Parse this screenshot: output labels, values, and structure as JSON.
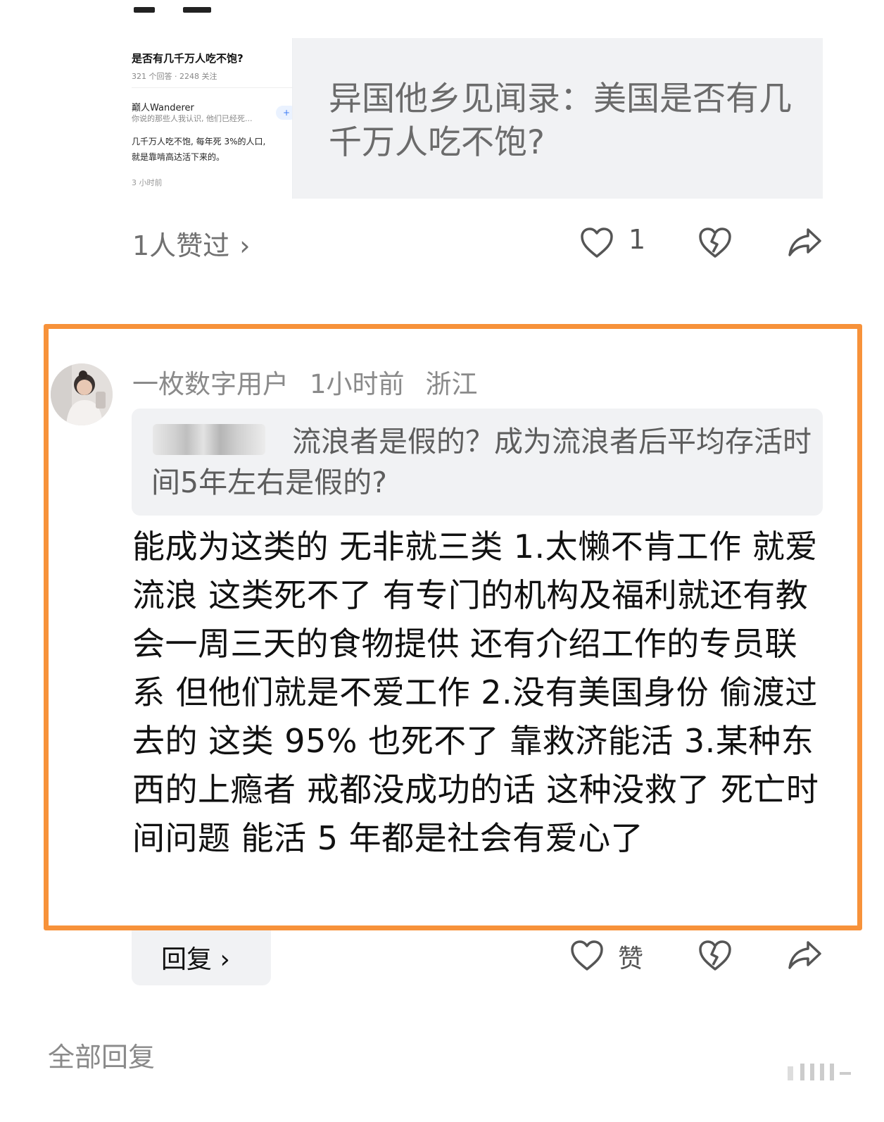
{
  "link_card": {
    "thumb_question": "是否有几千万人吃不饱?",
    "thumb_meta": "321 个回答 · 2248 关注",
    "thumb_author": "巅人Wanderer",
    "thumb_snippet": "你说的那些人我认识, 他们已经死...",
    "thumb_follow": "+",
    "thumb_body_1": "几千万人吃不饱, 每年死 3%的人口,",
    "thumb_body_2": "就是靠啃高达活下来的。",
    "thumb_time": "3 小时前",
    "title": "异国他乡见闻录：美国是否有几千万人吃不饱?"
  },
  "post_actions": {
    "likers_text": "1人赞过",
    "chevron": "›",
    "like_count": "1"
  },
  "comment": {
    "username": "一枚数字用户",
    "time": "1小时前",
    "location": "浙江",
    "quoted_text": "流浪者是假的？成为流浪者后平均存活时间5年左右是假的?",
    "body": "能成为这类的 无非就三类 1.太懒不肯工作 就爱流浪 这类死不了 有专门的机构及福利就还有教会一周三天的食物提供 还有介绍工作的专员联系 但他们就是不爱工作 2.没有美国身份 偷渡过去的 这类 95% 也死不了 靠救济能活 3.某种东西的上瘾者 戒都没成功的话 这种没救了 死亡时间问题 能活 5 年都是社会有爱心了",
    "reply_label": "回复 ›",
    "like_label": "赞"
  },
  "footer": {
    "all_replies": "全部回复"
  },
  "colors": {
    "highlight": "#f7923a",
    "card_bg": "#f1f2f4",
    "muted_text": "#8a8a8a"
  }
}
